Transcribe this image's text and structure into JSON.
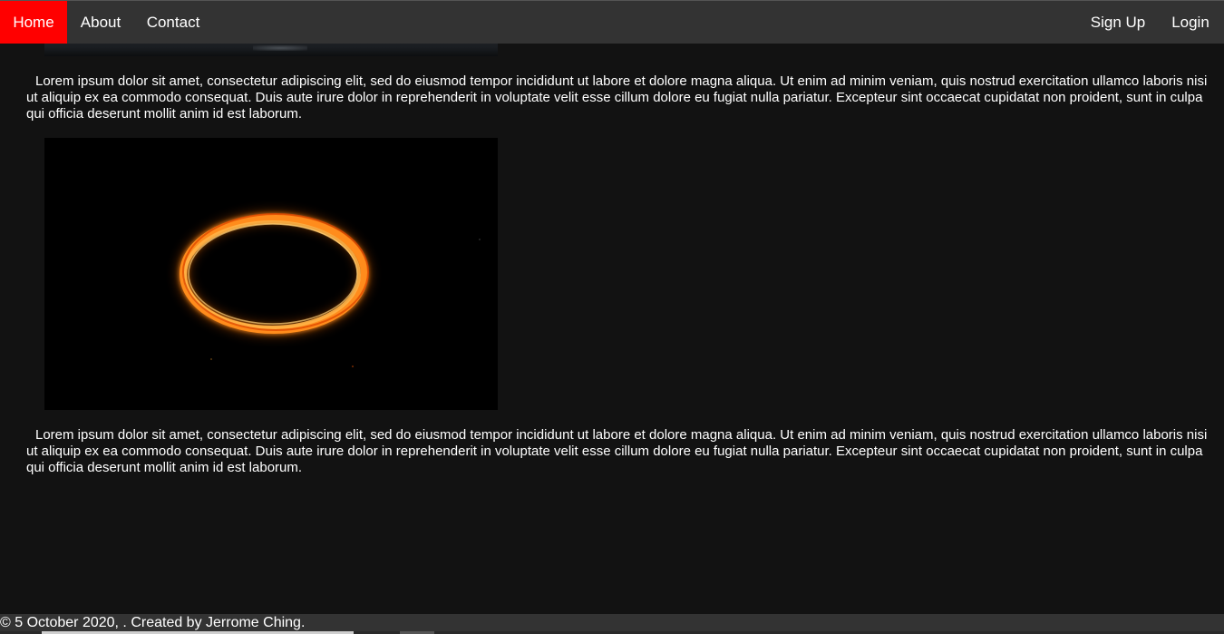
{
  "nav": {
    "left": [
      {
        "label": "Home",
        "active": true
      },
      {
        "label": "About",
        "active": false
      },
      {
        "label": "Contact",
        "active": false
      }
    ],
    "right": [
      {
        "label": "Sign Up"
      },
      {
        "label": "Login"
      }
    ],
    "active_color": "#ff0000",
    "bar_color": "#333333"
  },
  "main": {
    "paragraph_1": "Lorem ipsum dolor sit amet, consectetur adipiscing elit, sed do eiusmod tempor incididunt ut labore et dolore magna aliqua. Ut enim ad minim veniam, quis nostrud exercitation ullamco laboris nisi ut aliquip ex ea commodo consequat. Duis aute irure dolor in reprehenderit in voluptate velit esse cillum dolore eu fugiat nulla pariatur. Excepteur sint occaecat cupidatat non proident, sunt in culpa qui officia deserunt mollit anim id est laborum.",
    "paragraph_2": "Lorem ipsum dolor sit amet, consectetur adipiscing elit, sed do eiusmod tempor incididunt ut labore et dolore magna aliqua. Ut enim ad minim veniam, quis nostrud exercitation ullamco laboris nisi ut aliquip ex ea commodo consequat. Duis aute irure dolor in reprehenderit in voluptate velit esse cillum dolore eu fugiat nulla pariatur. Excepteur sint occaecat cupidatat non proident, sunt in culpa qui officia deserunt mollit anim id est laborum.",
    "background_color": "#121212"
  },
  "footer": {
    "text": "© 5 October 2020, . Created by Jerrome Ching."
  }
}
